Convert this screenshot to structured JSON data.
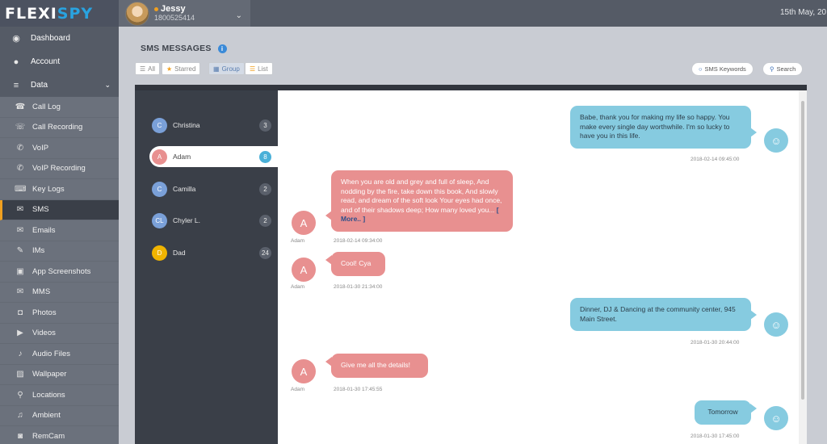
{
  "app": {
    "logo_left": "FLEXI",
    "logo_right": "SPY",
    "date": "15th May, 20"
  },
  "user": {
    "name": "Jessy",
    "phone": "1800525414"
  },
  "sidebar": {
    "top": [
      {
        "label": "Dashboard",
        "icon": "dashboard-icon"
      },
      {
        "label": "Account",
        "icon": "user-icon"
      },
      {
        "label": "Data",
        "icon": "database-icon"
      }
    ],
    "items": [
      {
        "label": "Call Log",
        "icon": "phone-icon"
      },
      {
        "label": "Call Recording",
        "icon": "phone-recording-icon"
      },
      {
        "label": "VoIP",
        "icon": "voip-icon"
      },
      {
        "label": "VoIP Recording",
        "icon": "voip-recording-icon"
      },
      {
        "label": "Key Logs",
        "icon": "keyboard-icon"
      },
      {
        "label": "SMS",
        "icon": "chat-bubble-icon"
      },
      {
        "label": "Emails",
        "icon": "envelope-icon"
      },
      {
        "label": "IMs",
        "icon": "im-icon"
      },
      {
        "label": "App Screenshots",
        "icon": "image-icon"
      },
      {
        "label": "MMS",
        "icon": "mms-icon"
      },
      {
        "label": "Photos",
        "icon": "camera-icon"
      },
      {
        "label": "Videos",
        "icon": "video-icon"
      },
      {
        "label": "Audio Files",
        "icon": "speaker-icon"
      },
      {
        "label": "Wallpaper",
        "icon": "picture-icon"
      },
      {
        "label": "Locations",
        "icon": "map-pin-icon"
      },
      {
        "label": "Ambient",
        "icon": "microphone-icon"
      },
      {
        "label": "RemCam",
        "icon": "remcam-icon"
      }
    ]
  },
  "page": {
    "title": "SMS MESSAGES"
  },
  "filters": {
    "all": "All",
    "starred": "Starred",
    "group": "Group",
    "list": "List"
  },
  "actions": {
    "keywords": "SMS Keywords",
    "search": "Search"
  },
  "contacts": [
    {
      "initials": "C",
      "name": "Christina",
      "count": "3",
      "color": "#7aa0d8"
    },
    {
      "initials": "A",
      "name": "Adam",
      "count": "8",
      "color": "#e89090"
    },
    {
      "initials": "C",
      "name": "Camilla",
      "count": "2",
      "color": "#7aa0d8"
    },
    {
      "initials": "CL",
      "name": "Chyler L.",
      "count": "2",
      "color": "#7aa0d8"
    },
    {
      "initials": "D",
      "name": "Dad",
      "count": "24",
      "color": "#f0b400"
    }
  ],
  "messages": [
    {
      "dir": "out",
      "text": "Babe, thank you for making my life so happy. You make every single day worthwhile. I'm so lucky to have you in this life.",
      "time": "2018-02-14 09:45:00"
    },
    {
      "dir": "in",
      "sender": "Adam",
      "avatar": "A",
      "text": "When you are old and grey and full of sleep, And nodding by the fire, take down this book, And slowly read, and dream of the soft look Your eyes had once, and of their shadows deep; How many loved you...",
      "more": "[ More.. ]",
      "time": "2018-02-14 09:34:00"
    },
    {
      "dir": "in",
      "sender": "Adam",
      "avatar": "A",
      "text": "Cool! Cya",
      "time": "2018-01-30 21:34:00"
    },
    {
      "dir": "out",
      "text": "Dinner, DJ & Dancing at the community center, 945 Main Street.",
      "time": "2018-01-30 20:44:00"
    },
    {
      "dir": "in",
      "sender": "Adam",
      "avatar": "A",
      "text": "Give me all the details!",
      "time": "2018-01-30 17:45:55"
    },
    {
      "dir": "out",
      "text": "Tomorrow",
      "time": "2018-01-30 17:45:00"
    }
  ]
}
